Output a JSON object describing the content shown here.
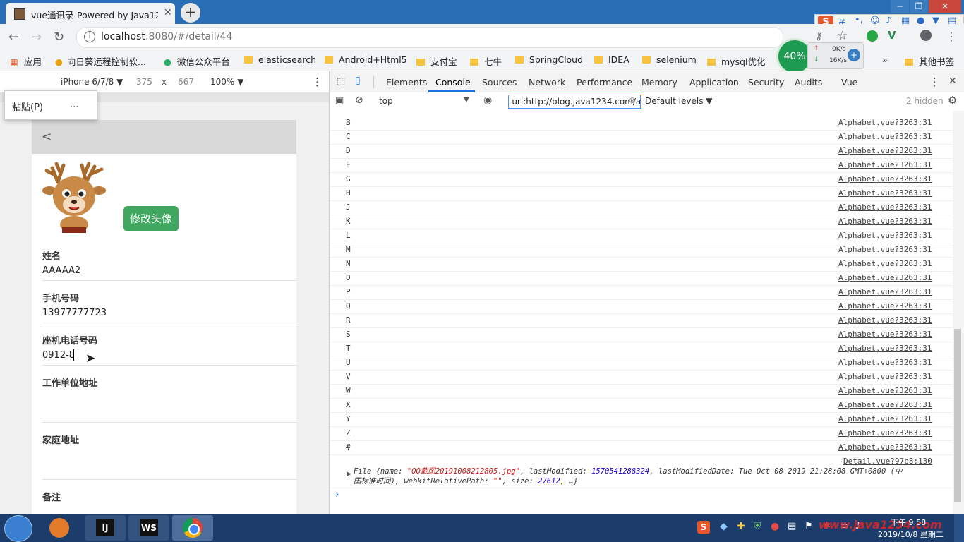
{
  "browser": {
    "tab_title": "vue通讯录-Powered by Java12",
    "url_host": "localhost",
    "url_rest": ":8080/#/detail/44",
    "bookmarks": [
      "应用",
      "向日葵远程控制软...",
      "微信公众平台",
      "elasticsearch",
      "Android+Html5",
      "支付宝",
      "七牛",
      "SpringCloud",
      "IDEA",
      "selenium",
      "mysql优化"
    ],
    "more": "»",
    "other_bookmarks": "其他书签"
  },
  "ime": {
    "label": "英"
  },
  "speed": {
    "percent": "40%",
    "up": "0K/s",
    "down": "16K/s"
  },
  "device_toolbar": {
    "device": "iPhone 6/7/8 ▼",
    "width": "375",
    "times": "x",
    "height": "667",
    "zoom": "100% ▼"
  },
  "context_menu": {
    "paste": "粘贴(P)",
    "more": "..."
  },
  "form": {
    "back": "<",
    "change_avatar": "修改头像",
    "name_label": "姓名",
    "name_value": "AAAAA2",
    "mobile_label": "手机号码",
    "mobile_value": "13977777723",
    "landline_label": "座机电话号码",
    "landline_value": "0912-8",
    "work_label": "工作单位地址",
    "home_label": "家庭地址",
    "note_label": "备注"
  },
  "devtools": {
    "tabs": [
      "Elements",
      "Console",
      "Sources",
      "Network",
      "Performance",
      "Memory",
      "Application",
      "Security",
      "Audits",
      "Vue"
    ],
    "context": "top",
    "filter": "-url:http://blog.java1234.com/a",
    "levels": "Default levels ▼",
    "hidden": "2 hidden",
    "rows": [
      {
        "letter": "B",
        "src": "Alphabet.vue?3263:31"
      },
      {
        "letter": "C",
        "src": "Alphabet.vue?3263:31"
      },
      {
        "letter": "D",
        "src": "Alphabet.vue?3263:31"
      },
      {
        "letter": "E",
        "src": "Alphabet.vue?3263:31"
      },
      {
        "letter": "G",
        "src": "Alphabet.vue?3263:31"
      },
      {
        "letter": "H",
        "src": "Alphabet.vue?3263:31"
      },
      {
        "letter": "J",
        "src": "Alphabet.vue?3263:31"
      },
      {
        "letter": "K",
        "src": "Alphabet.vue?3263:31"
      },
      {
        "letter": "L",
        "src": "Alphabet.vue?3263:31"
      },
      {
        "letter": "M",
        "src": "Alphabet.vue?3263:31"
      },
      {
        "letter": "N",
        "src": "Alphabet.vue?3263:31"
      },
      {
        "letter": "O",
        "src": "Alphabet.vue?3263:31"
      },
      {
        "letter": "P",
        "src": "Alphabet.vue?3263:31"
      },
      {
        "letter": "Q",
        "src": "Alphabet.vue?3263:31"
      },
      {
        "letter": "R",
        "src": "Alphabet.vue?3263:31"
      },
      {
        "letter": "S",
        "src": "Alphabet.vue?3263:31"
      },
      {
        "letter": "T",
        "src": "Alphabet.vue?3263:31"
      },
      {
        "letter": "U",
        "src": "Alphabet.vue?3263:31"
      },
      {
        "letter": "V",
        "src": "Alphabet.vue?3263:31"
      },
      {
        "letter": "W",
        "src": "Alphabet.vue?3263:31"
      },
      {
        "letter": "X",
        "src": "Alphabet.vue?3263:31"
      },
      {
        "letter": "Y",
        "src": "Alphabet.vue?3263:31"
      },
      {
        "letter": "Z",
        "src": "Alphabet.vue?3263:31"
      },
      {
        "letter": "#",
        "src": "Alphabet.vue?3263:31"
      }
    ],
    "detail_src": "Detail.vue?97b8:130",
    "file_line1_a": "File {name: ",
    "file_line1_name": "\"QQ截图20191008212805.jpg\"",
    "file_line1_b": ", lastModified: ",
    "file_line1_lm": "1570541288324",
    "file_line1_c": ", lastModifiedDate: Tue Oct 08 2019 21:28:08 GMT+0800 (中",
    "file_line2_a": "国标准时间), webkitRelativePath: ",
    "file_line2_path": "\"\"",
    "file_line2_b": ", size: ",
    "file_line2_size": "27612",
    "file_line2_c": ", …}",
    "prompt": "›"
  },
  "taskbar": {
    "time": "下午 9:58",
    "date": "2019/10/8 星期二",
    "watermark": "www.java1234.com"
  },
  "colors": {
    "accent_green": "#3fa75f",
    "titlebar": "#2a6fb6",
    "taskbar": "#1c3d6b"
  }
}
